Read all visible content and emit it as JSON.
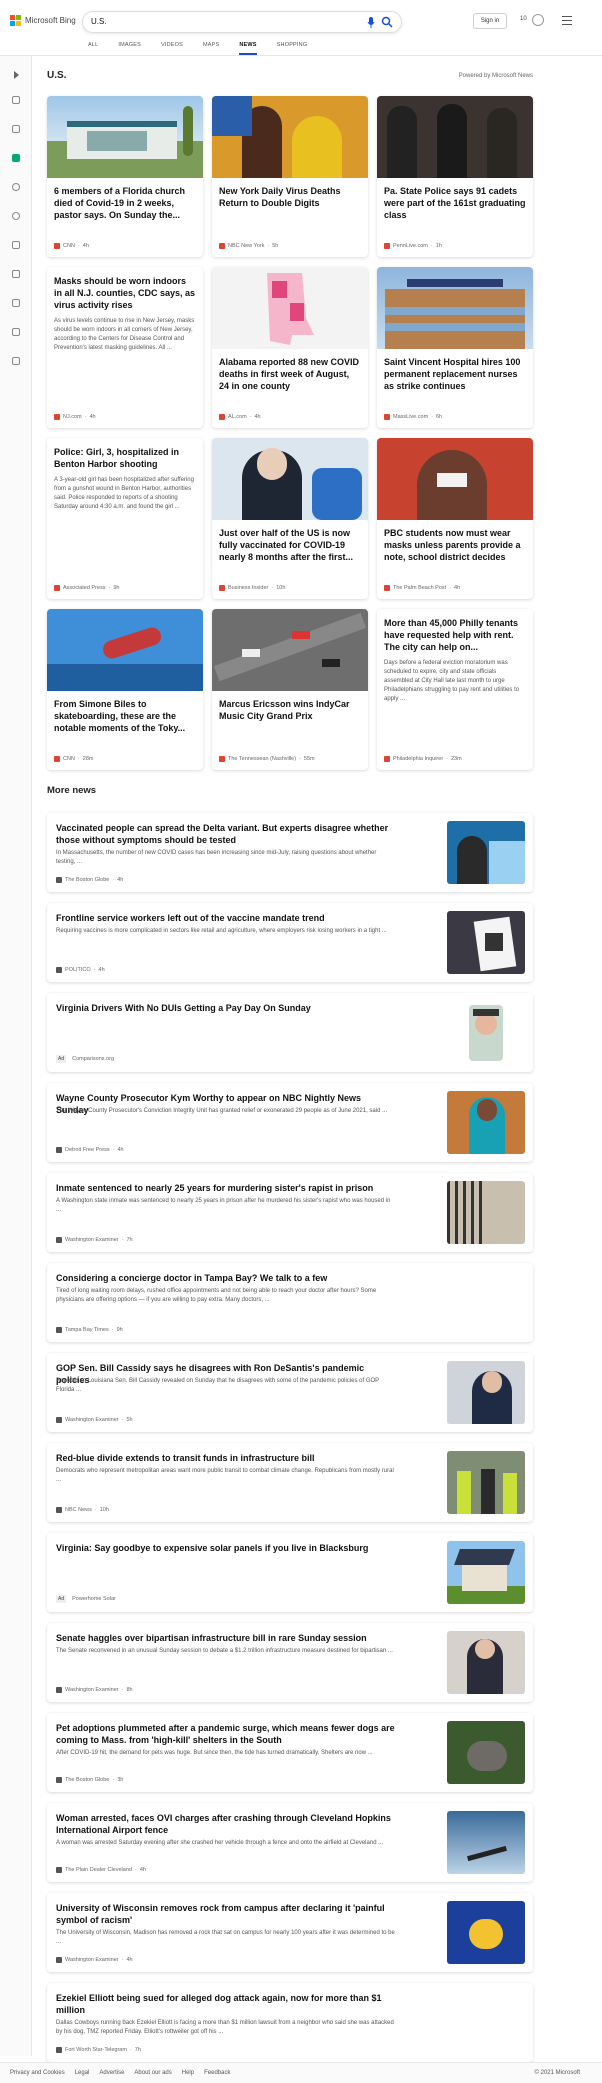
{
  "header": {
    "brand": "Microsoft Bing",
    "query": "U.S.",
    "signin": "Sign in",
    "points": "10"
  },
  "tabs": [
    "ALL",
    "IMAGES",
    "VIDEOS",
    "MAPS",
    "NEWS",
    "SHOPPING"
  ],
  "section": {
    "title": "U.S.",
    "powered": "Powered by Microsoft News"
  },
  "cards": [
    {
      "title": "6 members of a Florida church died of Covid-19 in 2 weeks, pastor says. On Sunday the...",
      "source": "CNN",
      "time": "4h",
      "img": "church"
    },
    {
      "title": "New York Daily Virus Deaths Return to Double Digits",
      "source": "NBC New York",
      "time": "5h",
      "img": "parade"
    },
    {
      "title": "Pa. State Police says 91 cadets were part of the 161st graduating class",
      "source": "PennLive.com",
      "time": "1h",
      "img": "cadets"
    },
    {
      "title": "Masks should be worn indoors in all N.J. counties, CDC says, as virus activity rises",
      "desc": "As virus levels continue to rise in New Jersey, masks should be worn indoors in all corners of New Jersey, according to the Centers for Disease Control and Prevention's latest masking guidelines. All ...",
      "source": "NJ.com",
      "time": "4h"
    },
    {
      "title": "Alabama reported 88 new COVID deaths in first week of August, 24 in one county",
      "source": "AL.com",
      "time": "4h",
      "img": "map"
    },
    {
      "title": "Saint Vincent Hospital hires 100 permanent replacement nurses as strike continues",
      "source": "MassLive.com",
      "time": "6h",
      "img": "hospital"
    },
    {
      "title": "Police: Girl, 3, hospitalized in Benton Harbor shooting",
      "desc": "A 3-year-old girl has been hospitalized after suffering from a gunshot wound in Benton Harbor, authorities said. Police responded to reports of a shooting Saturday around 4:30 a.m. and found the girl ...",
      "source": "Associated Press",
      "time": "9h"
    },
    {
      "title": "Just over half of the US is now fully vaccinated for COVID-19 nearly 8 months after the first...",
      "source": "Business Insider",
      "time": "10h",
      "img": "biden"
    },
    {
      "title": "PBC students now must wear masks unless parents provide a note, school district decides",
      "source": "The Palm Beach Post",
      "time": "4h",
      "img": "students"
    },
    {
      "title": "From Simone Biles to skateboarding, these are the notable moments of the Toky...",
      "source": "CNN",
      "time": "28m",
      "img": "biles"
    },
    {
      "title": "Marcus Ericsson wins IndyCar Music City Grand Prix",
      "source": "The Tennessean (Nashville)",
      "time": "55m",
      "img": "race"
    },
    {
      "title": "More than 45,000 Philly tenants have requested help with rent. The city can help on...",
      "desc": "Days before a federal eviction moratorium was scheduled to expire, city and state officials assembled at City Hall late last month to urge Philadelphians struggling to pay rent and utilities to apply ...",
      "source": "Philadelphia Inquirer",
      "time": "23m"
    }
  ],
  "more": {
    "title": "More news"
  },
  "rows": [
    {
      "title": "Vaccinated people can spread the Delta variant. But experts disagree whether those without symptoms should be tested",
      "desc": "In Massachusetts, the number of new COVID cases has been increasing since mid-July, raising questions about whether testing, ...",
      "source": "The Boston Globe",
      "time": "4h",
      "img": "testing"
    },
    {
      "title": "Frontline service workers left out of the vaccine mandate trend",
      "desc": "Requiring vaccines is more complicated in sectors like retail and agriculture, where employers risk losing workers in a tight ...",
      "source": "POLITICO",
      "time": "4h",
      "img": "proof"
    },
    {
      "title": "Virginia Drivers With No DUIs Getting a Pay Day On Sunday",
      "ad": "Ad",
      "source": "Comparisons.org",
      "img": "man"
    },
    {
      "title": "Wayne County Prosecutor Kym Worthy to appear on NBC Nightly News Sunday",
      "desc": "The Wayne County Prosecutor's Conviction Integrity Unit has granted relief or exonerated 29 people as of June 2021, said ...",
      "source": "Detroit Free Press",
      "time": "4h",
      "img": "worthy"
    },
    {
      "title": "Inmate sentenced to nearly 25 years for murdering sister's rapist in prison",
      "desc": "A Washington state inmate was sentenced to nearly 25 years in prison after he murdered his sister's rapist who was housed in ...",
      "source": "Washington Examiner",
      "time": "7h",
      "img": "prison"
    },
    {
      "title": "Considering a concierge doctor in Tampa Bay? We talk to a few",
      "desc": "Tired of long waiting room delays, rushed office appointments and not being able to reach your doctor after hours? Some physicians are offering options — if you are willing to pay extra. Many doctors, ...",
      "source": "Tampa Bay Times",
      "time": "9h"
    },
    {
      "title": "GOP Sen. Bill Cassidy says he disagrees with Ron DeSantis's pandemic policies",
      "desc": "Republican Louisiana Sen. Bill Cassidy revealed on Sunday that he disagrees with some of the pandemic policies of GOP Florida ...",
      "source": "Washington Examiner",
      "time": "5h",
      "img": "cassidy"
    },
    {
      "title": "Red-blue divide extends to transit funds in infrastructure bill",
      "desc": "Democrats who represent metropolitan areas want more public transit to combat climate change. Republicans from mostly rural ...",
      "source": "NBC News",
      "time": "10h",
      "img": "workers"
    },
    {
      "title": "Virginia: Say goodbye to expensive solar panels if you live in Blacksburg",
      "ad": "Ad",
      "source": "Powerhome Solar",
      "img": "house"
    },
    {
      "title": "Senate haggles over bipartisan infrastructure bill in rare Sunday session",
      "desc": "The Senate reconvened in an unusual Sunday session to debate a $1.2 trillion infrastructure measure destined for bipartisan ...",
      "source": "Washington Examiner",
      "time": "8h",
      "img": "senate"
    },
    {
      "title": "Pet adoptions plummeted after a pandemic surge, which means fewer dogs are coming to Mass. from 'high-kill' shelters in the South",
      "desc": "After COVID-19 hit, the demand for pets was huge. But since then, the tide has turned dramatically. Shelters are now ...",
      "source": "The Boston Globe",
      "time": "3h",
      "img": "dog"
    },
    {
      "title": "Woman arrested, faces OVI charges after crashing through Cleveland Hopkins International Airport fence",
      "desc": "A woman was arrested Saturday evening after she crashed her vehicle through a fence and onto the airfield at Cleveland ...",
      "source": "The Plain Dealer Cleveland",
      "time": "4h",
      "img": "plane"
    },
    {
      "title": "University of Wisconsin removes rock from campus after declaring it 'painful symbol of racism'",
      "desc": "The University of Wisconsin, Madison has removed a rock that sat on campus for nearly 100 years after it was determined to be ...",
      "source": "Washington Examiner",
      "time": "4h",
      "img": "flag"
    },
    {
      "title": "Ezekiel Elliott being sued for alleged dog attack again, now for more than $1 million",
      "desc": "Dallas Cowboys running back Ezekiel Elliott is facing a more than $1 million lawsuit from a neighbor who said she was attacked by his dog, TMZ reported Friday. Elliott's rottweiler got off his ...",
      "source": "Fort Worth Star-Telegram",
      "time": "7h"
    }
  ],
  "footer": {
    "links": [
      "Privacy and Cookies",
      "Legal",
      "Advertise",
      "About our ads",
      "Help",
      "Feedback"
    ],
    "copy": "© 2021 Microsoft"
  },
  "colors": {
    "accent": "#174ae4",
    "brand_red": "#f25022",
    "brand_green": "#7fba00",
    "brand_blue": "#00a4ef",
    "brand_yellow": "#ffb900"
  }
}
